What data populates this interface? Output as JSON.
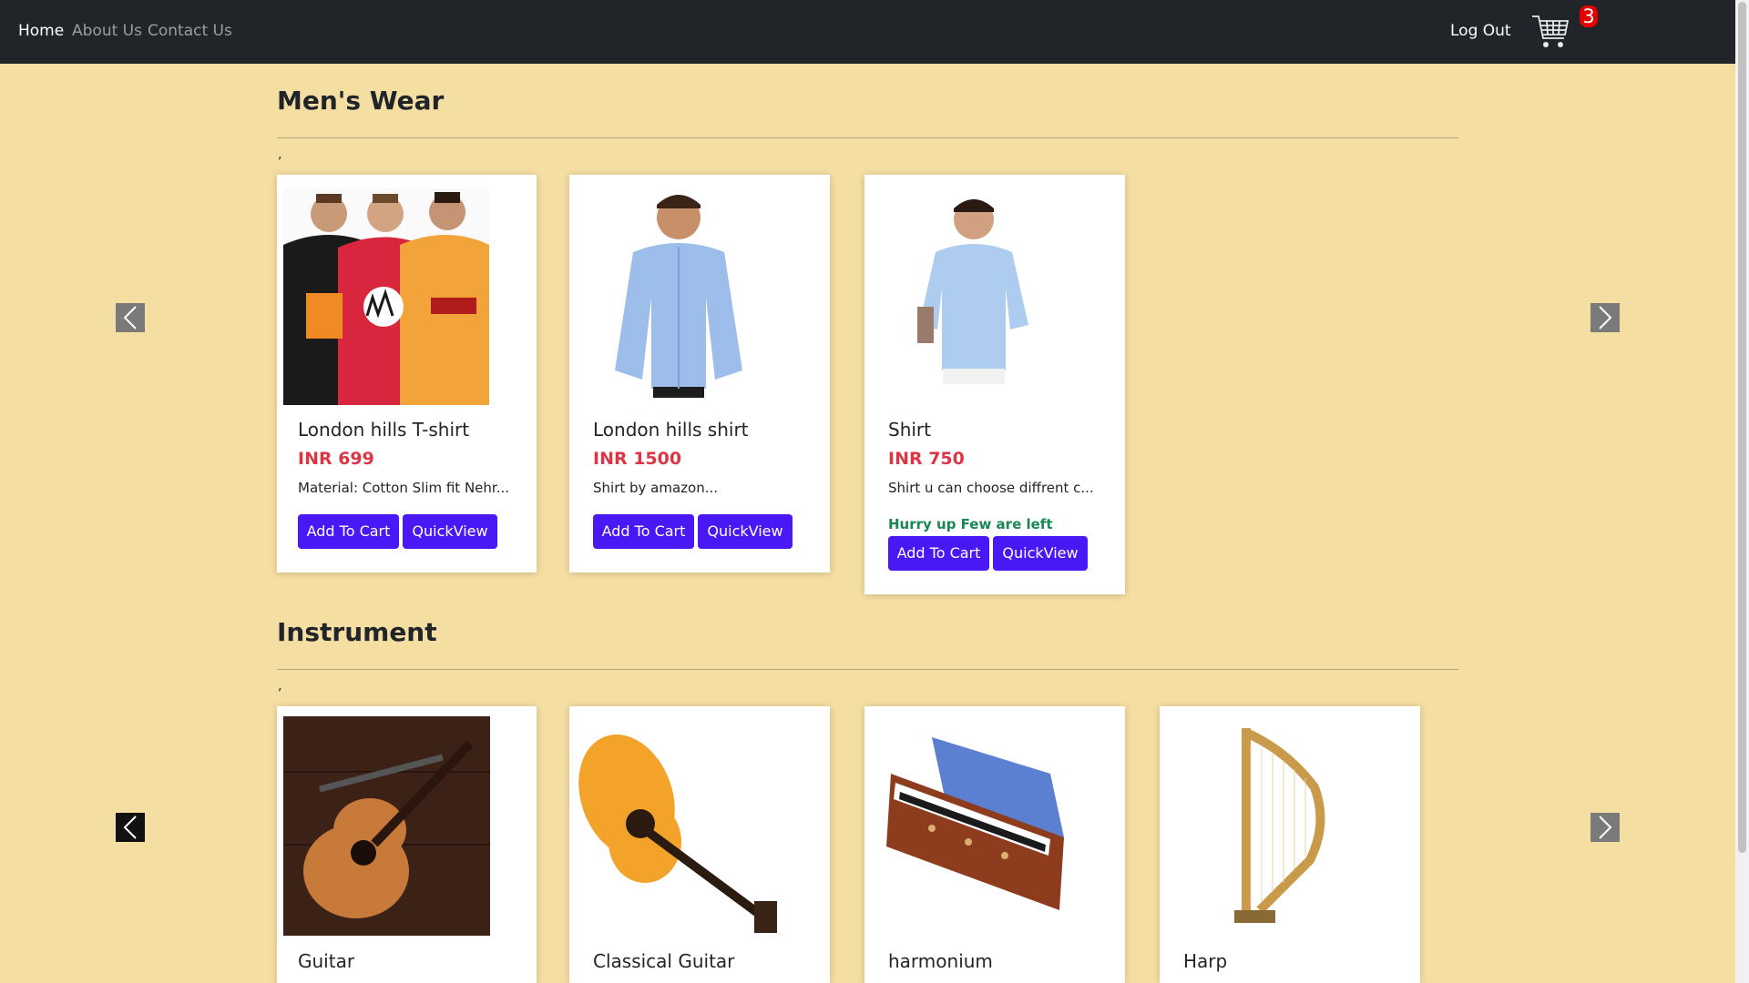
{
  "nav": {
    "home": "Home",
    "about": "About Us",
    "contact": "Contact Us",
    "logout": "Log Out",
    "cart_count": "3"
  },
  "sections": [
    {
      "title": "Men's Wear",
      "tick": ",",
      "products": [
        {
          "name": "London hills T-shirt",
          "price": "INR 699",
          "desc": "Material: Cotton Slim fit Nehr...",
          "hurry": "",
          "add": "Add To Cart",
          "quick": "QuickView"
        },
        {
          "name": "London hills shirt",
          "price": "INR 1500",
          "desc": "Shirt by amazon...",
          "hurry": "",
          "add": "Add To Cart",
          "quick": "QuickView"
        },
        {
          "name": "Shirt",
          "price": "INR 750",
          "desc": "Shirt u can choose diffrent c...",
          "hurry": "Hurry up Few are left",
          "add": "Add To Cart",
          "quick": "QuickView"
        }
      ]
    },
    {
      "title": "Instrument",
      "tick": ",",
      "products": [
        {
          "name": "Guitar"
        },
        {
          "name": "Classical Guitar"
        },
        {
          "name": "harmonium"
        },
        {
          "name": "Harp"
        }
      ]
    }
  ],
  "colors": {
    "page_bg": "#f5dea2",
    "navbar": "#212529",
    "button": "#4a17f5",
    "price": "#dc3545",
    "hurry": "#198754",
    "badge": "#e40000"
  },
  "icons": [
    "cart-icon",
    "chevron-left-icon",
    "chevron-right-icon"
  ]
}
